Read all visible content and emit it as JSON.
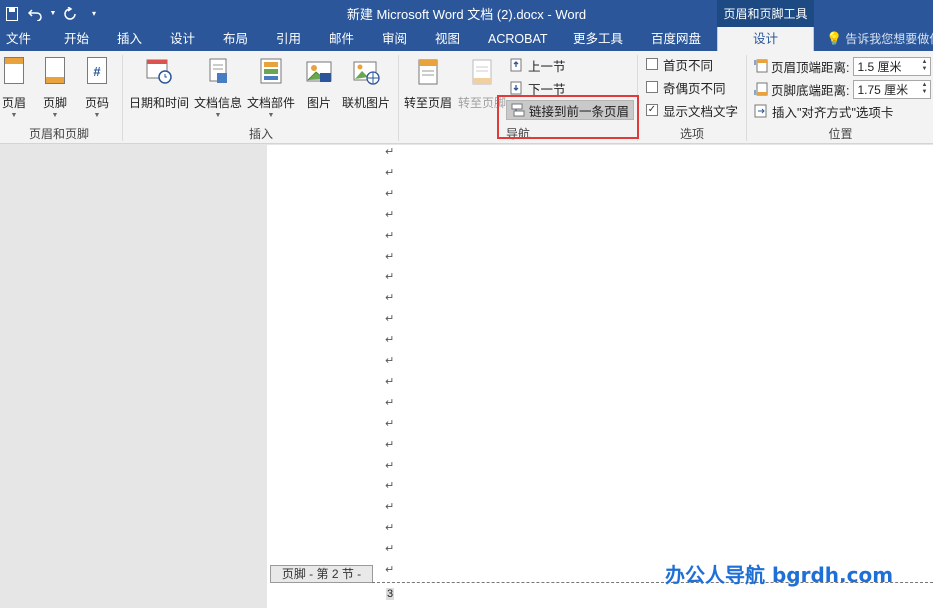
{
  "title_bar": {
    "title": "新建 Microsoft Word 文档 (2).docx - Word",
    "context_tab_title": "页眉和页脚工具",
    "qat": {
      "save_icon": "save-icon",
      "undo_icon": "undo-icon",
      "redo_icon": "redo-icon",
      "customize_icon": "customize-qat-icon"
    }
  },
  "tabs": [
    "文件",
    "开始",
    "插入",
    "设计",
    "布局",
    "引用",
    "邮件",
    "审阅",
    "视图",
    "ACROBAT",
    "更多工具",
    "百度网盘",
    "设计"
  ],
  "active_tab_index": 12,
  "tell_me": {
    "placeholder": "告诉我您想要做什么"
  },
  "ribbon": {
    "header_footer_group": {
      "label": "页眉和页脚",
      "buttons": [
        "页眉",
        "页脚",
        "页码"
      ]
    },
    "insert_group": {
      "label": "插入",
      "buttons": [
        "日期和时间",
        "文档信息",
        "文档部件",
        "图片",
        "联机图片"
      ]
    },
    "navigation_group": {
      "label": "导航",
      "goto_header": "转至页眉",
      "goto_footer": "转至页脚",
      "previous_section": "上一节",
      "next_section": "下一节",
      "link_to_previous": "链接到前一条页眉"
    },
    "options_group": {
      "label": "选项",
      "different_first_page": {
        "label": "首页不同",
        "checked": false
      },
      "different_odd_even": {
        "label": "奇偶页不同",
        "checked": false
      },
      "show_document_text": {
        "label": "显示文档文字",
        "checked": true
      }
    },
    "position_group": {
      "label": "位置",
      "header_from_top": {
        "label": "页眉顶端距离:",
        "value": "1.5 厘米"
      },
      "footer_from_bottom": {
        "label": "页脚底端距离:",
        "value": "1.75 厘米"
      },
      "insert_alignment_tab": "插入\"对齐方式\"选项卡"
    }
  },
  "document": {
    "paragraph_mark": "↵",
    "footer_label": "页脚 - 第 2 节 -",
    "page_number": "3"
  },
  "watermark": "办公人导航  bgrdh.com",
  "colors": {
    "title_bar": "#2b579a",
    "highlight_box": "#e03a3a",
    "watermark": "#1e6fd6"
  }
}
